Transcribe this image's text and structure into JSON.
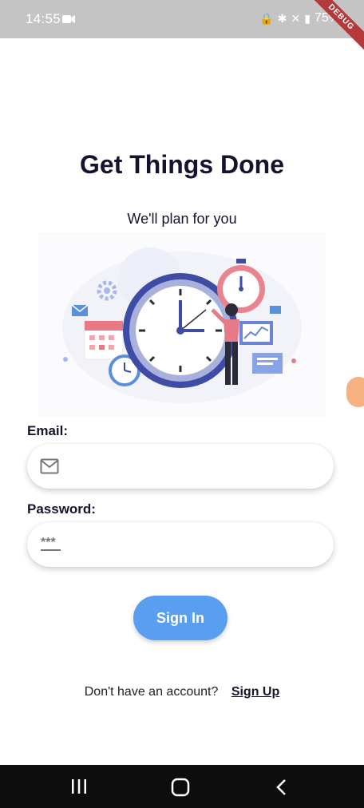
{
  "status_bar": {
    "time": "14:55",
    "battery": "75%",
    "debug_label": "DEBUG"
  },
  "header": {
    "title": "Get Things Done",
    "subtitle": "We'll plan for you"
  },
  "form": {
    "email_label": "Email:",
    "email_value": "",
    "password_label": "Password:",
    "password_value": "",
    "password_icon_text": "***",
    "signin_label": "Sign In"
  },
  "footer": {
    "prompt": "Don't have an account?",
    "signup_label": "Sign Up"
  },
  "colors": {
    "accent": "#5a9ef0",
    "title": "#14142e",
    "status_bar": "#c4c4c4",
    "nav_bar": "#0d0d0d"
  },
  "icons": [
    "video-camera-icon",
    "mail-icon",
    "password-icon",
    "recent-apps-icon",
    "home-icon",
    "back-icon"
  ]
}
